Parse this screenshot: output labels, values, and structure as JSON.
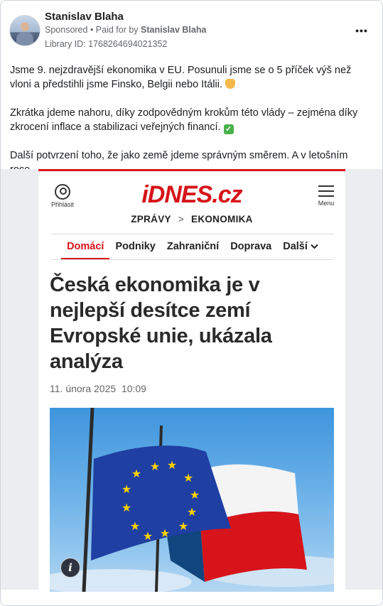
{
  "post": {
    "page_name": "Stanislav Blaha",
    "sponsored_label": "Sponsored",
    "paid_prefix": " • Paid for by ",
    "paid_by": "Stanislav Blaha",
    "library_id": "Library ID: 1768264694021352",
    "more_label": "•••",
    "paragraphs": [
      "Jsme 9. nejzdravější ekonomika v EU. Posunuli jsme se o 5 příček výš než vloni a předstihli jsme Finsko, Belgii nebo Itálii.",
      "Zkrátka jdeme nahoru, díky zodpovědným krokům této vlády – zejména díky zkrocení inflace a stabilizaci veřejných financí.",
      "Další potvrzení toho, že jako země jdeme správným směrem. A v letošním roce…"
    ]
  },
  "article": {
    "logo": "iDNES.cz",
    "login_label": "Přihlásit",
    "menu_label": "Menu",
    "breadcrumb": {
      "section": "ZPRÁVY",
      "separator": ">",
      "subsection": "EKONOMIKA"
    },
    "tabs": [
      "Domácí",
      "Podniky",
      "Zahraniční",
      "Doprava",
      "Další"
    ],
    "headline": "Česká ekonomika je v nejlepší desítce zemí Evropské unie, ukázala analýza",
    "date": "11. února 2025",
    "time": "10:09",
    "info_label": "i"
  },
  "colors": {
    "brand_red": "#d7141a",
    "eu_blue": "#1f3fa3",
    "eu_star": "#ffd200",
    "cz_red": "#d7141a",
    "cz_blue": "#11457e",
    "cz_white": "#ffffff"
  }
}
